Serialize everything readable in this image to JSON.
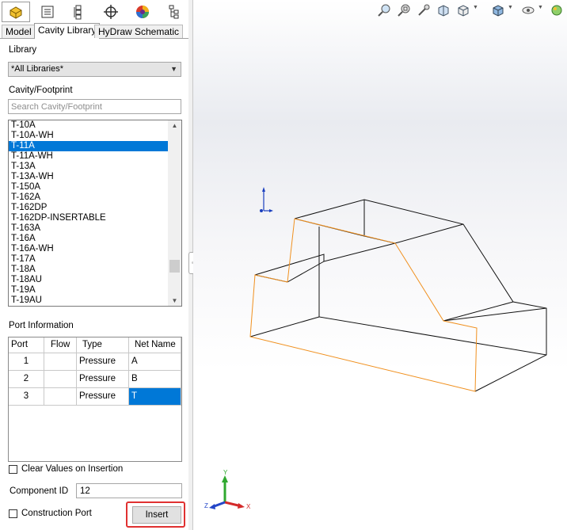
{
  "feature_tabs": [
    {
      "icon": "part-icon"
    },
    {
      "icon": "property-manager-icon"
    },
    {
      "icon": "configuration-manager-icon"
    },
    {
      "icon": "dimxpert-icon"
    },
    {
      "icon": "appearance-icon"
    },
    {
      "icon": "hierarchy-icon"
    }
  ],
  "tabs": [
    {
      "label": "Model"
    },
    {
      "label": "Cavity Library"
    },
    {
      "label": "HyDraw Schematic"
    }
  ],
  "library": {
    "label": "Library",
    "selected": "*All Libraries*"
  },
  "cavity": {
    "label": "Cavity/Footprint",
    "search_placeholder": "Search Cavity/Footprint",
    "items": [
      "T-10A",
      "T-10A-WH",
      "T-11A",
      "T-11A-WH",
      "T-13A",
      "T-13A-WH",
      "T-150A",
      "T-162A",
      "T-162DP",
      "T-162DP-INSERTABLE",
      "T-163A",
      "T-16A",
      "T-16A-WH",
      "T-17A",
      "T-18A",
      "T-18AU",
      "T-19A",
      "T-19AU"
    ],
    "selected_index": 2
  },
  "port_info": {
    "label": "Port Information",
    "columns": [
      "Port",
      "Flow",
      "Type",
      "Net Name"
    ],
    "rows": [
      {
        "port": "1",
        "flow": "",
        "type": "Pressure",
        "net": "A"
      },
      {
        "port": "2",
        "flow": "",
        "type": "Pressure",
        "net": "B"
      },
      {
        "port": "3",
        "flow": "",
        "type": "Pressure",
        "net": "T"
      }
    ]
  },
  "clear_values": {
    "label": "Clear Values on Insertion",
    "checked": false
  },
  "component_id": {
    "label": "Component ID",
    "value": "12"
  },
  "construction_port": {
    "label": "Construction Port",
    "checked": false
  },
  "insert": {
    "label": "Insert"
  },
  "heads_up_toolbar": [
    "zoom-to-fit-icon",
    "zoom-to-area-icon",
    "previous-view-icon",
    "section-view-icon",
    "view-orientation-icon",
    "display-style-icon",
    "hide-show-items-icon",
    "edit-appearance-icon"
  ],
  "triad_axes": {
    "x": "X",
    "y": "Y",
    "z": "Z"
  },
  "colors": {
    "selection": "#0078d7",
    "highlight_border": "#e03131",
    "edge_highlight": "#f0901e"
  }
}
